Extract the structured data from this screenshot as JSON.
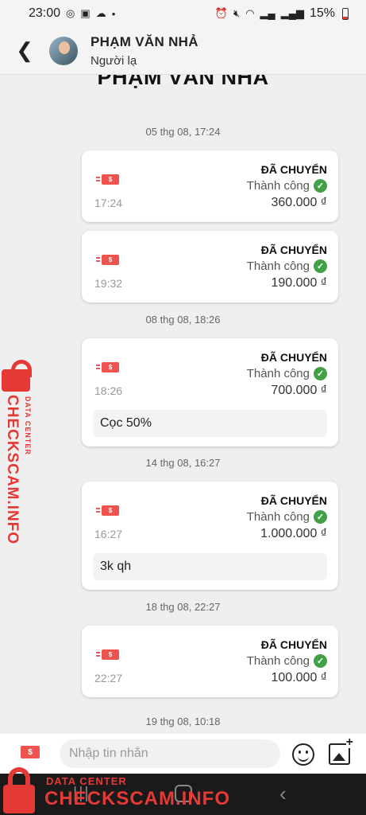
{
  "status_bar": {
    "time": "23:00",
    "battery": "15%",
    "left_icons": [
      "messenger-icon",
      "gallery-icon",
      "cloud-icon",
      "dot-icon"
    ],
    "right_icons": [
      "alarm-icon",
      "mute-icon",
      "wifi-icon",
      "signal-icon",
      "signal-icon",
      "battery-icon"
    ]
  },
  "header": {
    "name": "PHẠM VĂN NHẢ",
    "subtitle": "Người lạ"
  },
  "chat": {
    "banner_name": "PHẠM VĂN NHẢ",
    "groups": [
      {
        "date": "05 thg 08, 17:24",
        "cards": [
          {
            "title": "ĐÃ CHUYỂN",
            "status": "Thành công",
            "amount": "360.000 ₫",
            "time": "17:24",
            "icon_label": "$"
          },
          {
            "title": "ĐÃ CHUYỂN",
            "status": "Thành công",
            "amount": "190.000 ₫",
            "time": "19:32",
            "icon_label": "$"
          }
        ]
      },
      {
        "date": "08 thg 08, 18:26",
        "cards": [
          {
            "title": "ĐÃ CHUYỂN",
            "status": "Thành công",
            "amount": "700.000 ₫",
            "time": "18:26",
            "icon_label": "$",
            "note": "Cọc 50%"
          }
        ]
      },
      {
        "date": "14 thg 08, 16:27",
        "cards": [
          {
            "title": "ĐÃ CHUYỂN",
            "status": "Thành công",
            "amount": "1.000.000 ₫",
            "time": "16:27",
            "icon_label": "$",
            "note": "3k qh"
          }
        ]
      },
      {
        "date": "18 thg 08, 22:27",
        "cards": [
          {
            "title": "ĐÃ CHUYỂN",
            "status": "Thành công",
            "amount": "100.000 ₫",
            "time": "22:27",
            "icon_label": "$"
          }
        ]
      },
      {
        "date": "19 thg 08, 10:18",
        "cards": []
      }
    ]
  },
  "input": {
    "placeholder": "Nhập tin nhắn",
    "money_icon_label": "$"
  },
  "watermark": {
    "brand": "CHECKSCAM.INFO",
    "tagline": "DATA CENTER"
  },
  "colors": {
    "accent_red": "#e53935",
    "success_green": "#43a047",
    "card_bg": "#ffffff",
    "chat_bg": "#efefef"
  }
}
